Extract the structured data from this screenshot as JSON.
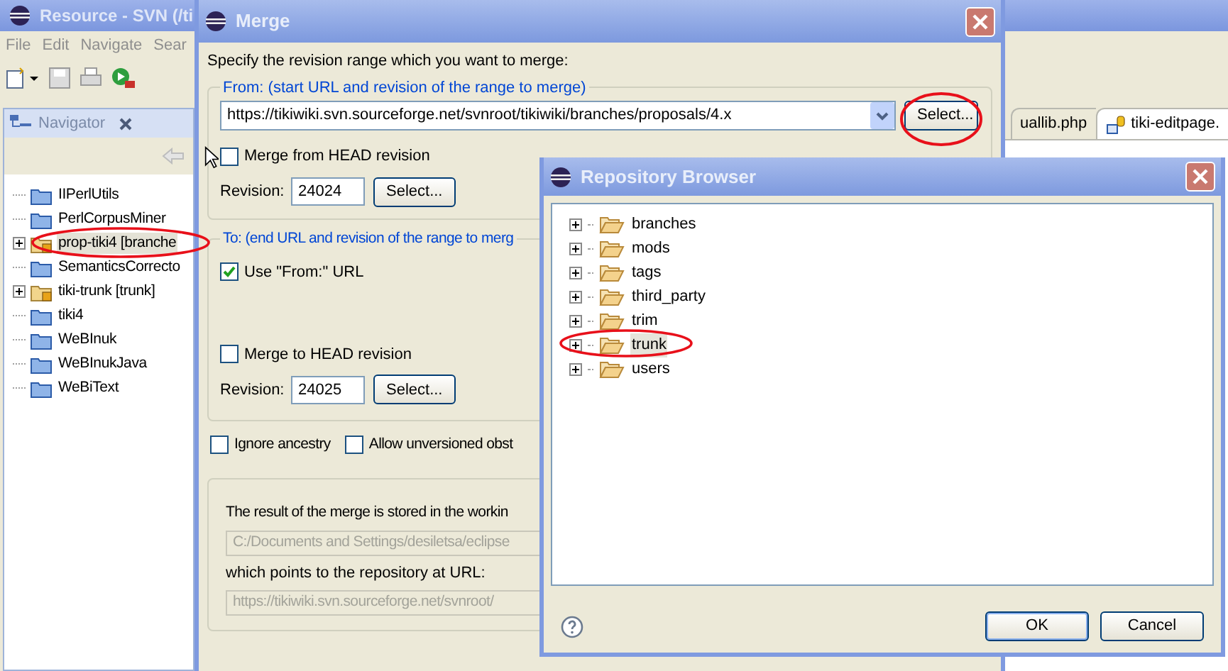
{
  "main_window": {
    "title": "Resource - SVN (/ti",
    "menu": [
      "File",
      "Edit",
      "Navigate",
      "Sear"
    ],
    "navigator": {
      "title": "Navigator",
      "items": [
        {
          "label": "IIPerlUtils",
          "kind": "project",
          "expandable": false,
          "selected": false
        },
        {
          "label": "PerlCorpusMiner",
          "kind": "project",
          "expandable": false,
          "selected": false
        },
        {
          "label": "prop-tiki4 [branche",
          "kind": "svn_project",
          "expandable": true,
          "selected": true
        },
        {
          "label": "SemanticsCorrecto",
          "kind": "project",
          "expandable": false,
          "selected": false
        },
        {
          "label": "tiki-trunk [trunk]",
          "kind": "svn_project",
          "expandable": true,
          "selected": false
        },
        {
          "label": "tiki4",
          "kind": "project",
          "expandable": false,
          "selected": false
        },
        {
          "label": "WeBInuk",
          "kind": "project",
          "expandable": false,
          "selected": false
        },
        {
          "label": "WeBInukJava",
          "kind": "project",
          "expandable": false,
          "selected": false
        },
        {
          "label": "WeBiText",
          "kind": "project",
          "expandable": false,
          "selected": false
        }
      ]
    },
    "editor_tabs": [
      {
        "label": "uallib.php",
        "selected": false
      },
      {
        "label": "tiki-editpage.",
        "selected": true
      }
    ]
  },
  "merge_dialog": {
    "title": "Merge",
    "instruction": "Specify the revision range which you want to merge:",
    "from": {
      "label": "From: (start URL and revision of the range to merge)",
      "url": "https://tikiwiki.svn.sourceforge.net/svnroot/tikiwiki/branches/proposals/4.x",
      "url_select": "Select...",
      "head_revision": {
        "label": "Merge from HEAD revision",
        "checked": false
      },
      "revision_label": "Revision:",
      "revision": "24024",
      "revision_select": "Select..."
    },
    "to": {
      "label": "To: (end URL and revision of the range to merg",
      "use_from": {
        "label": "Use \"From:\" URL",
        "checked": true
      },
      "head_revision": {
        "label": "Merge to HEAD revision",
        "checked": false
      },
      "revision_label": "Revision:",
      "revision": "24025",
      "revision_select": "Select..."
    },
    "options": [
      {
        "label": "Ignore ancestry",
        "checked": false
      },
      {
        "label": "Allow unversioned obst",
        "checked": false
      }
    ],
    "result": {
      "text": "The result of the merge is stored in the workin",
      "path": "C:/Documents and Settings/desiletsa/eclipse",
      "url_text": "which points to the repository at URL:",
      "url": "https://tikiwiki.svn.sourceforge.net/svnroot/"
    }
  },
  "repository_browser": {
    "title": "Repository Browser",
    "items": [
      {
        "label": "branches",
        "selected": false
      },
      {
        "label": "mods",
        "selected": false
      },
      {
        "label": "tags",
        "selected": false
      },
      {
        "label": "third_party",
        "selected": false
      },
      {
        "label": "trim",
        "selected": false
      },
      {
        "label": "trunk",
        "selected": true
      },
      {
        "label": "users",
        "selected": false
      }
    ],
    "buttons": [
      "OK",
      "Cancel"
    ]
  }
}
